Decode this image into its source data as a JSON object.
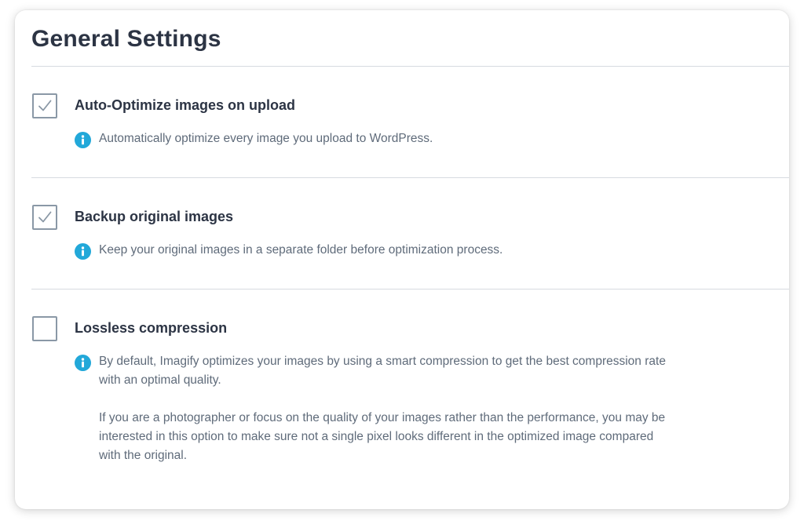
{
  "page": {
    "title": "General Settings"
  },
  "settings": [
    {
      "label": "Auto-Optimize images on upload",
      "checked": true,
      "description": [
        "Automatically optimize every image you upload to WordPress."
      ]
    },
    {
      "label": "Backup original images",
      "checked": true,
      "description": [
        "Keep your original images in a separate folder before optimization process."
      ]
    },
    {
      "label": "Lossless compression",
      "checked": false,
      "description": [
        "By default, Imagify optimizes your images by using a smart compression to get the best compression rate with an optimal quality.",
        "If you are a photographer or focus on the quality of your images rather than the performance, you may be interested in this option to make sure not a single pixel looks different in the optimized image compared with the original."
      ]
    }
  ],
  "colors": {
    "info_icon": "#22a8d9",
    "checkmark": "#8a98a6",
    "divider": "#d7dbe0"
  }
}
